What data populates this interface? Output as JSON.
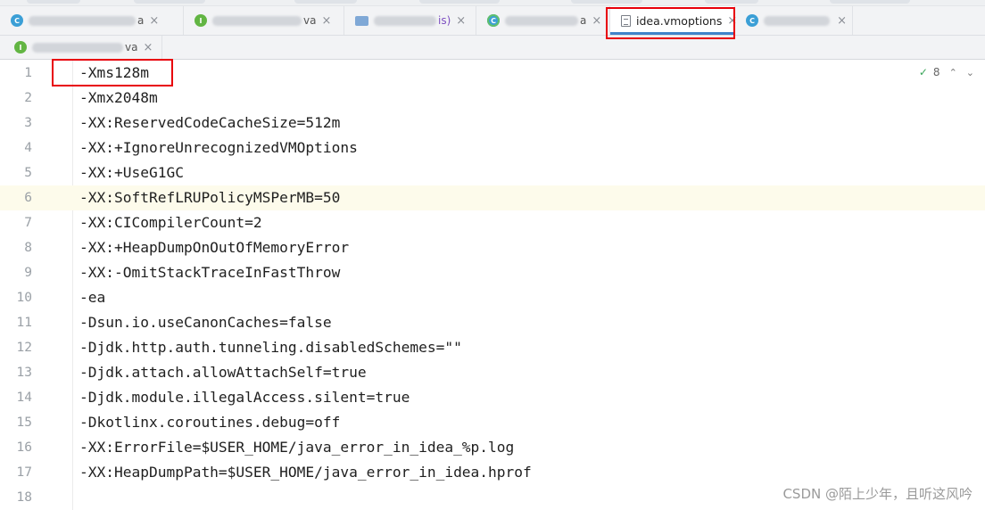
{
  "tabs_row1": [
    {
      "id": "t1",
      "icon": "C",
      "label_fragment": "a",
      "closable": true
    },
    {
      "id": "t2",
      "icon": "I",
      "label_fragment": "va",
      "closable": true
    },
    {
      "id": "t3",
      "icon": "folder",
      "label_fragment": "is)",
      "closable": true
    },
    {
      "id": "t4",
      "icon": "C",
      "label_fragment": "a",
      "closable": true
    },
    {
      "id": "t5",
      "icon": "file",
      "label": "idea.vmoptions",
      "closable": true,
      "active": true
    },
    {
      "id": "t6",
      "icon": "C",
      "label_fragment": "",
      "closable": true
    }
  ],
  "tabs_row2": [
    {
      "id": "t7",
      "icon": "I",
      "label_fragment": "va",
      "closable": true
    }
  ],
  "close_glyph": "×",
  "inspection": {
    "count": "8",
    "up": "⌃",
    "down": "⌄",
    "check": "✓"
  },
  "editor": {
    "current_line": 6,
    "lines": [
      {
        "n": "1",
        "text": "-Xms128m"
      },
      {
        "n": "2",
        "text": "-Xmx2048m"
      },
      {
        "n": "3",
        "text": "-XX:ReservedCodeCacheSize=512m"
      },
      {
        "n": "4",
        "text": "-XX:+IgnoreUnrecognizedVMOptions"
      },
      {
        "n": "5",
        "text": "-XX:+UseG1GC"
      },
      {
        "n": "6",
        "text": "-XX:SoftRefLRUPolicyMSPerMB=50"
      },
      {
        "n": "7",
        "text": "-XX:CICompilerCount=2"
      },
      {
        "n": "8",
        "text": "-XX:+HeapDumpOnOutOfMemoryError"
      },
      {
        "n": "9",
        "text": "-XX:-OmitStackTraceInFastThrow"
      },
      {
        "n": "10",
        "text": "-ea"
      },
      {
        "n": "11",
        "text": "-Dsun.io.useCanonCaches=false"
      },
      {
        "n": "12",
        "text": "-Djdk.http.auth.tunneling.disabledSchemes=\"\""
      },
      {
        "n": "13",
        "text": "-Djdk.attach.allowAttachSelf=true"
      },
      {
        "n": "14",
        "text": "-Djdk.module.illegalAccess.silent=true"
      },
      {
        "n": "15",
        "text": "-Dkotlinx.coroutines.debug=off"
      },
      {
        "n": "16",
        "text": "-XX:ErrorFile=$USER_HOME/java_error_in_idea_%p.log"
      },
      {
        "n": "17",
        "text": "-XX:HeapDumpPath=$USER_HOME/java_error_in_idea.hprof"
      },
      {
        "n": "18",
        "text": ""
      }
    ]
  },
  "watermark": "CSDN @陌上少年，且听这风吟",
  "colors": {
    "highlight_box": "#e8000b",
    "active_tab_underline": "#4083c9",
    "current_line_bg": "#fdfbeb"
  }
}
